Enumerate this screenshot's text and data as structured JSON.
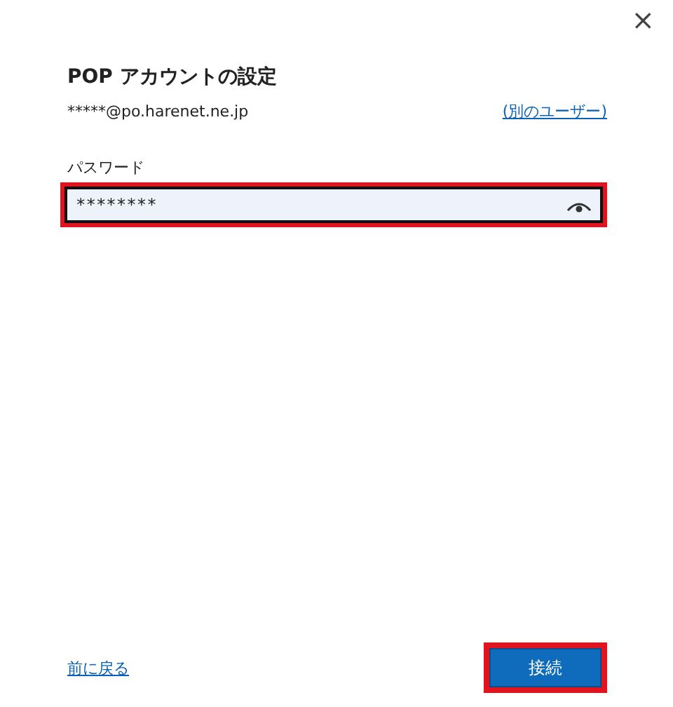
{
  "dialog": {
    "close": "×",
    "title": "POP アカウントの設定",
    "email": "*****@po.harenet.ne.jp",
    "switch_user_link": "(別のユーザー)",
    "password": {
      "label": "パスワード",
      "value": "********",
      "highlighted": true
    },
    "back_link": "前に戻る",
    "connect_button": {
      "label": "接続",
      "highlighted": true
    }
  }
}
